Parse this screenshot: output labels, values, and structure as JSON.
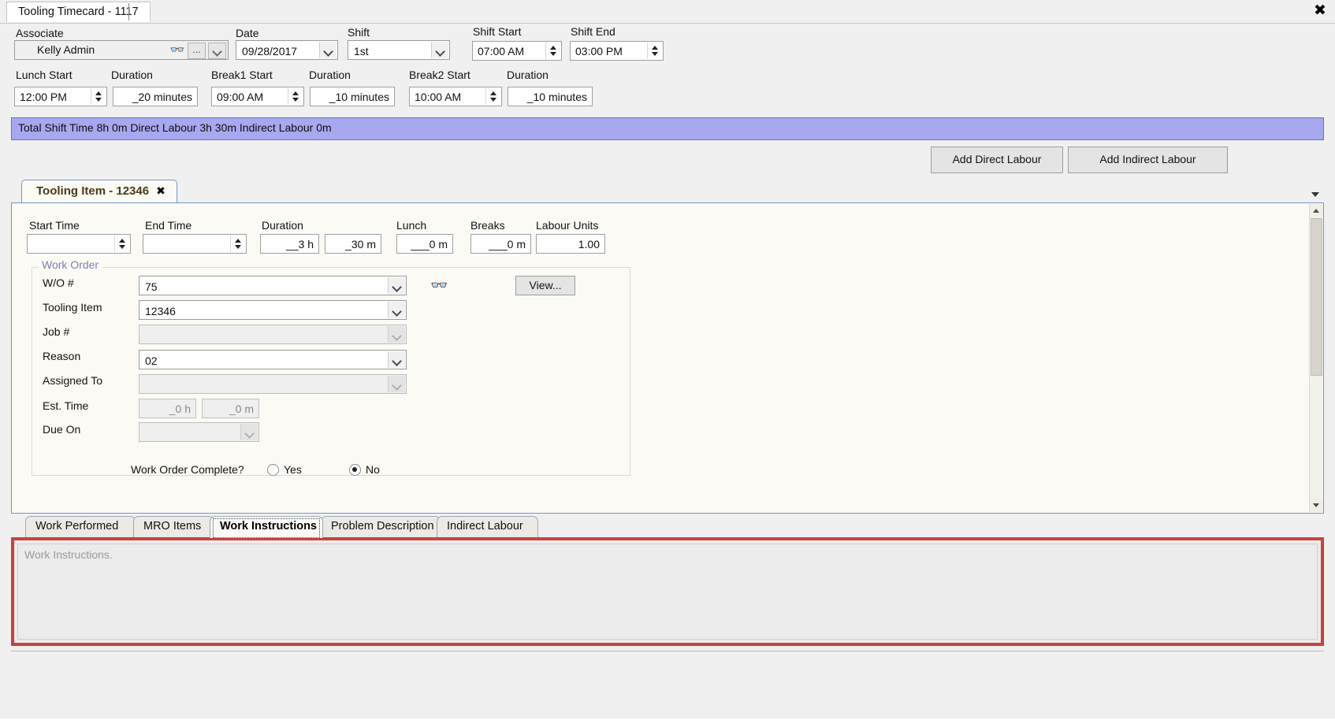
{
  "window": {
    "tab_title": "Tooling Timecard - 1117",
    "close_icon": "close-icon"
  },
  "header": {
    "associate": {
      "label": "Associate",
      "value": "Kelly Admin",
      "search_icon": "binoculars-icon",
      "ellipsis_label": "...",
      "chevron_icon": "chevron-down-icon"
    },
    "date": {
      "label": "Date",
      "value": "09/28/2017"
    },
    "shift": {
      "label": "Shift",
      "value": "1st"
    },
    "shift_start": {
      "label": "Shift Start",
      "value": "07:00 AM"
    },
    "shift_end": {
      "label": "Shift End",
      "value": "03:00 PM"
    },
    "lunch_start": {
      "label": "Lunch Start",
      "value": "12:00 PM"
    },
    "lunch_duration": {
      "label": "Duration",
      "value": "_20 minutes"
    },
    "break1_start": {
      "label": "Break1 Start",
      "value": "09:00 AM"
    },
    "break1_duration": {
      "label": "Duration",
      "value": "_10 minutes"
    },
    "break2_start": {
      "label": "Break2 Start",
      "value": "10:00 AM"
    },
    "break2_duration": {
      "label": "Duration",
      "value": "_10 minutes"
    }
  },
  "summary": {
    "text": "Total Shift Time 8h 0m  Direct Labour 3h 30m  Indirect Labour 0m",
    "background_color": "#a8a8f0"
  },
  "actions": {
    "add_direct_labour": "Add Direct Labour",
    "add_indirect_labour": "Add Indirect Labour"
  },
  "item_tab": {
    "label": "Tooling Item - 12346",
    "close_icon": "close-icon",
    "overflow_icon": "chevron-down-icon"
  },
  "entry": {
    "start_time": {
      "label": "Start Time",
      "value": ""
    },
    "end_time": {
      "label": "End Time",
      "value": ""
    },
    "duration": {
      "label": "Duration",
      "hours": "__3 h",
      "minutes": "_30 m"
    },
    "lunch": {
      "label": "Lunch",
      "value": "___0 m"
    },
    "breaks": {
      "label": "Breaks",
      "value": "___0 m"
    },
    "labour_units": {
      "label": "Labour Units",
      "value": "1.00"
    }
  },
  "work_order": {
    "group_title": "Work Order",
    "wo_number": {
      "label": "W/O #",
      "value": "75"
    },
    "tooling_item": {
      "label": "Tooling Item",
      "value": "12346"
    },
    "job_number": {
      "label": "Job #",
      "value": ""
    },
    "reason": {
      "label": "Reason",
      "value": "02"
    },
    "assigned_to": {
      "label": "Assigned To",
      "value": ""
    },
    "est_time": {
      "label": "Est. Time",
      "hours": "_0 h",
      "minutes": "_0 m"
    },
    "due_on": {
      "label": "Due On",
      "value": ""
    },
    "search_icon": "binoculars-icon",
    "view_button": "View...",
    "complete": {
      "label": "Work Order Complete?",
      "yes_label": "Yes",
      "no_label": "No",
      "selected": "No"
    }
  },
  "bottom_tabs": {
    "items": [
      {
        "label": "Work Performed",
        "active": false
      },
      {
        "label": "MRO Items",
        "active": false
      },
      {
        "label": "Work Instructions",
        "active": true
      },
      {
        "label": "Problem Description",
        "active": false
      },
      {
        "label": "Indirect Labour",
        "active": false
      }
    ],
    "highlight_color": "#c9413d"
  },
  "work_instructions": {
    "placeholder": "Work Instructions.",
    "value": ""
  }
}
